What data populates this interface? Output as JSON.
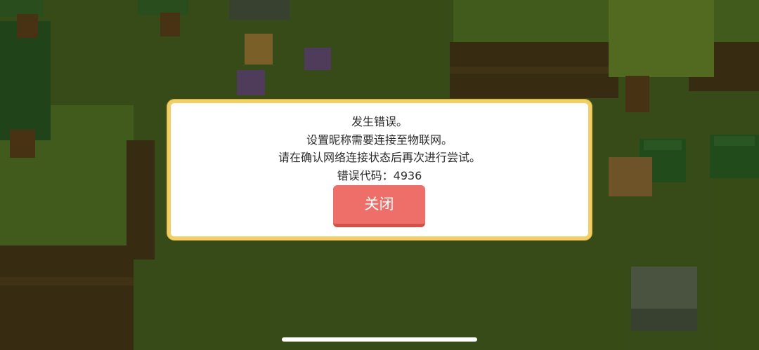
{
  "dialog": {
    "lines": [
      "发生错误。",
      "设置昵称需要连接至物联网。",
      "请在确认网络连接状态后再次进行尝试。"
    ],
    "error_code_label": "错误代码：",
    "error_code": "4936",
    "close_label": "关闭"
  },
  "colors": {
    "dialog_border": "#f2cf63",
    "close_button": "#ee6f6a",
    "grass": "#6f9a32"
  }
}
